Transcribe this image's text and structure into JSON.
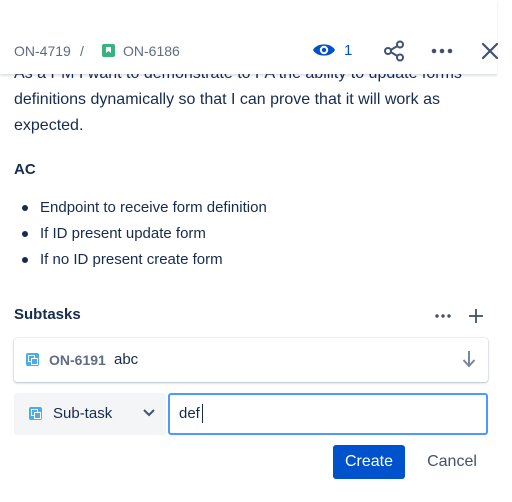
{
  "breadcrumb": {
    "parent_key": "ON-4719",
    "separator": "/",
    "issue_key": "ON-6186"
  },
  "header": {
    "watch_count": "1"
  },
  "description": {
    "cut_line": "As a PM I want to demonstrate to PA the ability to update forms",
    "line2": "definitions dynamically so that I can prove that it will work as",
    "line3": "expected.",
    "ac_heading": "AC",
    "bullets": [
      "Endpoint to receive form definition",
      "If ID present update form",
      "If no ID present create form"
    ]
  },
  "subtasks": {
    "heading": "Subtasks",
    "items": [
      {
        "key": "ON-6191",
        "summary": "abc"
      }
    ],
    "new_form": {
      "type_label": "Sub-task",
      "summary_value": "def",
      "create_label": "Create",
      "cancel_label": "Cancel"
    }
  },
  "colors": {
    "primary": "#0052CC",
    "story": "#36B37E",
    "subtask": "#4BADE8",
    "focus": "#4C9AFF"
  },
  "icons": [
    "story-icon",
    "eye-icon",
    "share-icon",
    "more-icon",
    "close-icon",
    "subtask-icon",
    "arrow-down-icon",
    "add-icon",
    "chevron-down-icon"
  ]
}
